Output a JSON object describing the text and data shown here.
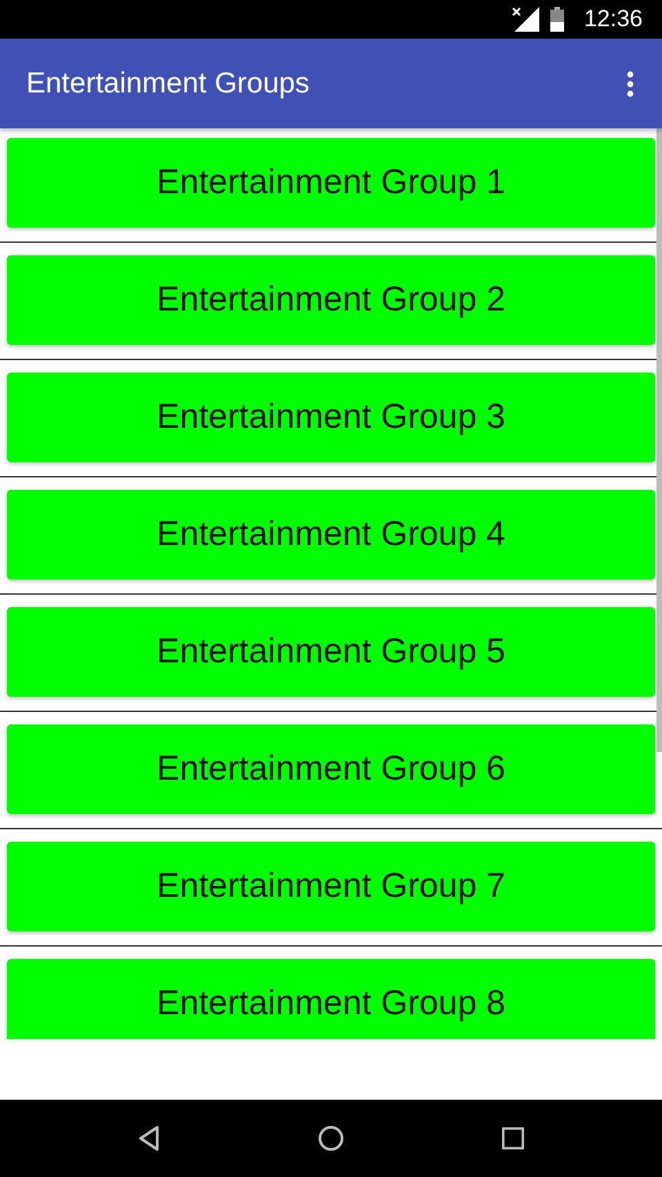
{
  "status_bar": {
    "time": "12:36"
  },
  "app_bar": {
    "title": "Entertainment Groups"
  },
  "groups": [
    {
      "label": "Entertainment Group 1"
    },
    {
      "label": "Entertainment Group 2"
    },
    {
      "label": "Entertainment Group 3"
    },
    {
      "label": "Entertainment Group 4"
    },
    {
      "label": "Entertainment Group 5"
    },
    {
      "label": "Entertainment Group 6"
    },
    {
      "label": "Entertainment Group 7"
    },
    {
      "label": "Entertainment Group 8"
    }
  ]
}
